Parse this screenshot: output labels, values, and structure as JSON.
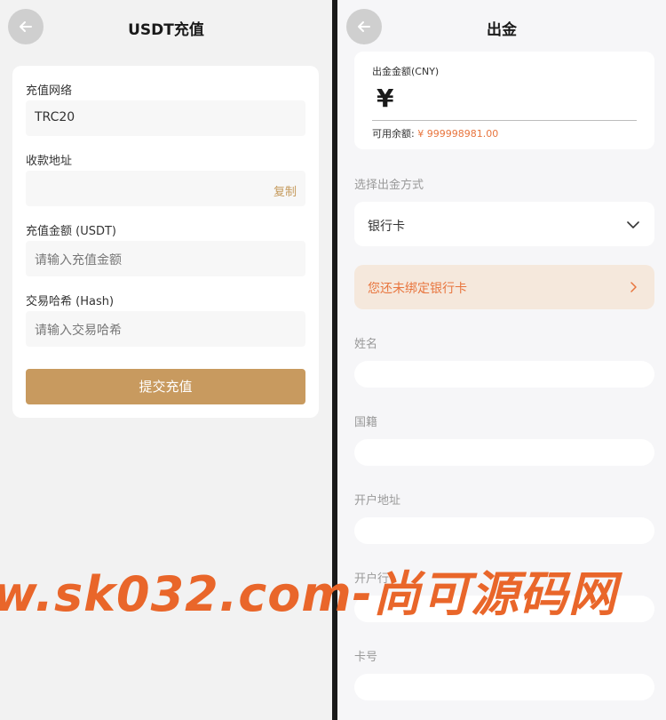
{
  "deposit": {
    "title": "USDT充值",
    "network_label": "充值网络",
    "network_value": "TRC20",
    "address_label": "收款地址",
    "address_value": "",
    "copy_label": "复制",
    "amount_label": "充值金额 (USDT)",
    "amount_placeholder": "请输入充值金额",
    "hash_label": "交易哈希 (Hash)",
    "hash_placeholder": "请输入交易哈希",
    "submit_label": "提交充值"
  },
  "withdraw": {
    "title": "出金",
    "amount_label": "出金金额(CNY)",
    "currency_symbol": "¥",
    "available_label": "可用余额:",
    "available_value": "¥ 999998981.00",
    "method_label": "选择出金方式",
    "method_value": "银行卡",
    "bind_notice": "您还未绑定银行卡",
    "name_label": "姓名",
    "nationality_label": "国籍",
    "address_label": "开户地址",
    "bank_label": "开户行",
    "card_label": "卡号"
  },
  "watermark": "w.sk032.com-尚可源码网",
  "colors": {
    "accent": "#c89a5f",
    "orange": "#e8753e",
    "banner": "#f5e8dc"
  },
  "icons": [
    "arrow-left-icon",
    "chevron-down-icon",
    "chevron-right-icon"
  ]
}
